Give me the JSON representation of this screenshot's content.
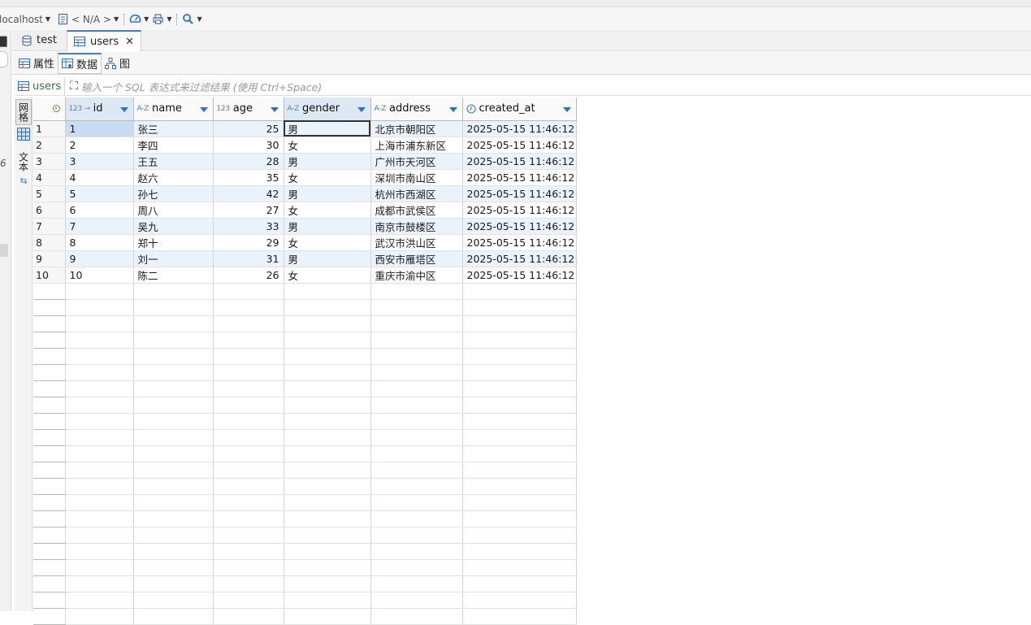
{
  "toolbar": {
    "connection": "localhost",
    "database": "< N/A >"
  },
  "tabs": [
    {
      "label": "test"
    },
    {
      "label": "users"
    }
  ],
  "subtabs": [
    {
      "label": "属性"
    },
    {
      "label": "数据"
    },
    {
      "label": "图"
    }
  ],
  "filter": {
    "table_name": "users",
    "placeholder": "输入一个 SQL 表达式来过滤结果 (使用 Ctrl+Space)"
  },
  "side": {
    "grid_label": "网格",
    "text_label": "文本"
  },
  "gutter": {
    "num": "6"
  },
  "columns": [
    {
      "type": "123",
      "name": "id",
      "key": true
    },
    {
      "type": "A-Z",
      "name": "name"
    },
    {
      "type": "123",
      "name": "age"
    },
    {
      "type": "A-Z",
      "name": "gender"
    },
    {
      "type": "A-Z",
      "name": "address"
    },
    {
      "type": "clock",
      "name": "created_at"
    }
  ],
  "rows": [
    [
      "1",
      "1",
      "张三",
      "25",
      "男",
      "北京市朝阳区",
      "2025-05-15 11:46:12"
    ],
    [
      "2",
      "2",
      "李四",
      "30",
      "女",
      "上海市浦东新区",
      "2025-05-15 11:46:12"
    ],
    [
      "3",
      "3",
      "王五",
      "28",
      "男",
      "广州市天河区",
      "2025-05-15 11:46:12"
    ],
    [
      "4",
      "4",
      "赵六",
      "35",
      "女",
      "深圳市南山区",
      "2025-05-15 11:46:12"
    ],
    [
      "5",
      "5",
      "孙七",
      "42",
      "男",
      "杭州市西湖区",
      "2025-05-15 11:46:12"
    ],
    [
      "6",
      "6",
      "周八",
      "27",
      "女",
      "成都市武侯区",
      "2025-05-15 11:46:12"
    ],
    [
      "7",
      "7",
      "吴九",
      "33",
      "男",
      "南京市鼓楼区",
      "2025-05-15 11:46:12"
    ],
    [
      "8",
      "8",
      "郑十",
      "29",
      "女",
      "武汉市洪山区",
      "2025-05-15 11:46:12"
    ],
    [
      "9",
      "9",
      "刘一",
      "31",
      "男",
      "西安市雁塔区",
      "2025-05-15 11:46:12"
    ],
    [
      "10",
      "10",
      "陈二",
      "26",
      "女",
      "重庆市渝中区",
      "2025-05-15 11:46:12"
    ]
  ],
  "colors": {
    "accent": "#3d7fd6",
    "row_stripe": "#eaf2fc",
    "table_label": "#2f7d32"
  }
}
